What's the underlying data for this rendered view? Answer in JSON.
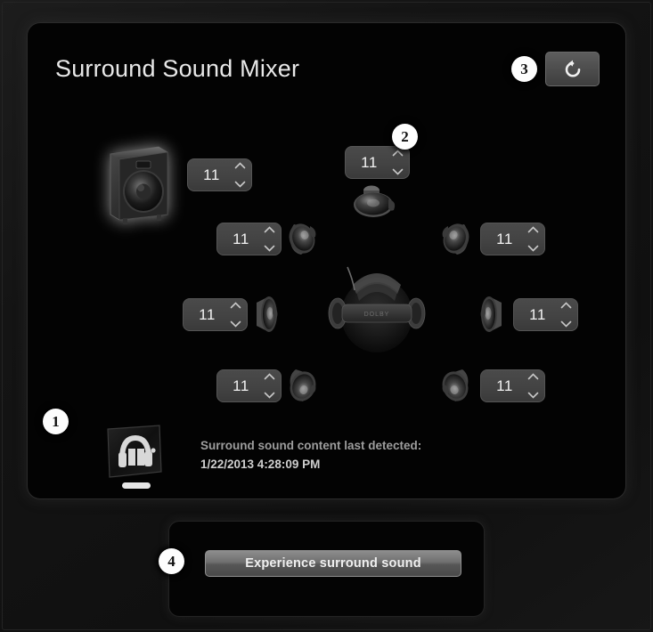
{
  "window": {
    "title": "Surround Sound Mixer"
  },
  "header": {
    "title": "Surround Sound Mixer",
    "reset_button": {
      "icon": "reset-circular-arrow-icon",
      "label": ""
    }
  },
  "callouts": [
    {
      "number": "1",
      "target": "dolby-logo"
    },
    {
      "number": "2",
      "target": "center-speaker-spinner"
    },
    {
      "number": "3",
      "target": "reset-button"
    },
    {
      "number": "4",
      "target": "experience-button"
    }
  ],
  "channels": [
    {
      "name": "subwoofer",
      "icon": "subwoofer-icon",
      "value": "11"
    },
    {
      "name": "center",
      "icon": "center-speaker-icon",
      "value": "11"
    },
    {
      "name": "front-left",
      "icon": "front-left-speaker-icon",
      "value": "11"
    },
    {
      "name": "front-right",
      "icon": "front-right-speaker-icon",
      "value": "11"
    },
    {
      "name": "side-left",
      "icon": "side-left-speaker-icon",
      "value": "11"
    },
    {
      "name": "side-right",
      "icon": "side-right-speaker-icon",
      "value": "11"
    },
    {
      "name": "rear-left",
      "icon": "rear-left-speaker-icon",
      "value": "11"
    },
    {
      "name": "rear-right",
      "icon": "rear-right-speaker-icon",
      "value": "11"
    }
  ],
  "spinner": {
    "up_arrow": "chevron-up-icon",
    "down_arrow": "chevron-down-icon"
  },
  "status": {
    "logo": "dolby-headphone-logo",
    "label": "Surround sound content last detected:",
    "timestamp": "1/22/2013 4:28:09 PM"
  },
  "center_graphic": {
    "icon": "listener-head-with-headphones-icon"
  },
  "footer": {
    "experience_button_label": "Experience surround sound"
  },
  "colors": {
    "panel_background": "#030303",
    "frame_background": "#141414",
    "title_text": "#e8e8e8",
    "status_text": "#9d9d9d",
    "spinner_background": "#434343",
    "button_highlight": "#8d8d8d"
  }
}
